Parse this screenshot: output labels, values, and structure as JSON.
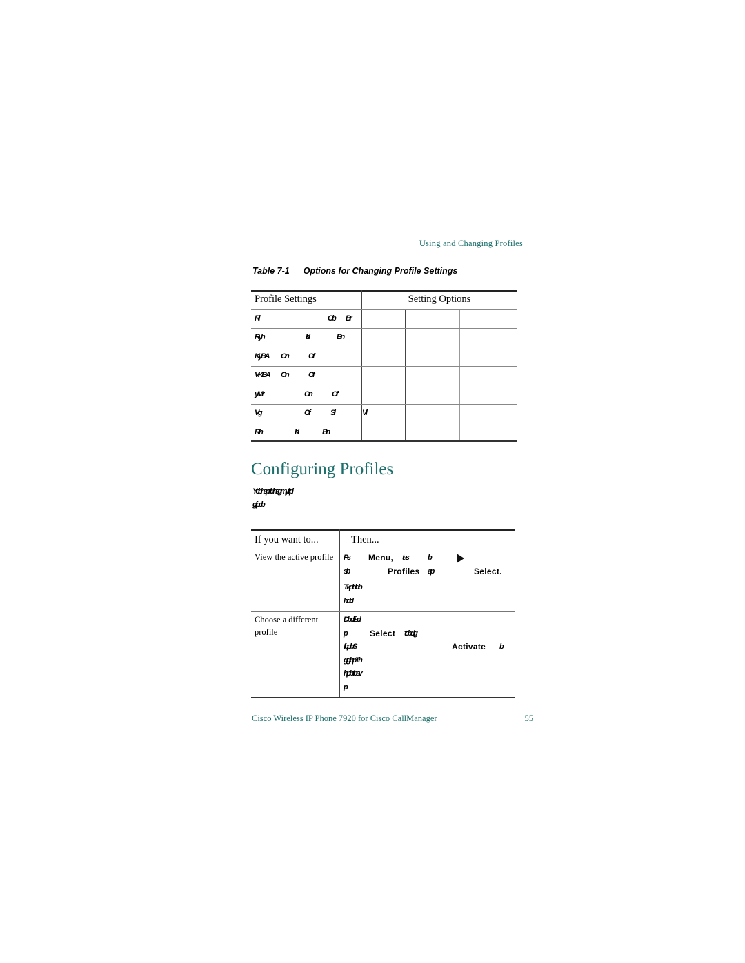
{
  "running_head": "Using and Changing Profiles",
  "table_caption": {
    "number": "Table 7-1",
    "title": "Options for Changing Profile Settings"
  },
  "profile_table": {
    "headers": [
      "Profile Settings",
      "Setting Options"
    ],
    "rows": [
      {
        "label": "Ri",
        "opt1": "Ob",
        "opt2": "Br",
        "opt3": ""
      },
      {
        "label": "Ryh",
        "opt1": "Isl",
        "opt2": "Bn",
        "opt3": ""
      },
      {
        "label": "KyBA",
        "opt1": "On",
        "opt2": "Of",
        "opt3": ""
      },
      {
        "label": "VKBA",
        "opt1": "On",
        "opt2": "Of",
        "opt3": ""
      },
      {
        "label": "yMr",
        "opt1": "On",
        "opt2": "Of",
        "opt3": ""
      },
      {
        "label": "Vg",
        "opt1": "Of",
        "opt2": "Sl",
        "opt3": "Vl"
      },
      {
        "label": "Rih",
        "opt1": "Isl",
        "opt2": "Bn",
        "opt3": ""
      }
    ]
  },
  "section": {
    "title": "Configuring Profiles",
    "intro_lines": [
      "Ycbhsprfdnsgmyfrpl",
      "gfpcb"
    ]
  },
  "action_table": {
    "headers": [
      "If you want to...",
      "Then..."
    ],
    "rows": [
      {
        "action": "View the active profile",
        "steps": [
          {
            "g1": "Ps",
            "kw": "Menu,",
            "g2": "tas",
            "g3": "b",
            "arrow": "right-arrow-icon"
          },
          {
            "g1": "sb",
            "kw": "Profiles",
            "g2": "ap",
            "kw2": "Select."
          },
          {
            "g1": "Tkplddb"
          },
          {
            "g1": "hdcl"
          }
        ]
      },
      {
        "action": "Choose a different profile",
        "steps": [
          {
            "g1": "Dbcllfsd"
          },
          {
            "g1": "p",
            "kw": "Select",
            "g2": "tcbdg"
          },
          {
            "g1": "fcpbS",
            "kw": "Activate",
            "g2": "b"
          },
          {
            "g1": "ggbpTh"
          },
          {
            "g1": "hpbtbev"
          },
          {
            "g1": "p"
          }
        ]
      }
    ]
  },
  "footer": {
    "title": "Cisco Wireless IP Phone 7920 for Cisco CallManager",
    "page": "55"
  },
  "colors": {
    "accent_teal": "#1c6f6c"
  }
}
